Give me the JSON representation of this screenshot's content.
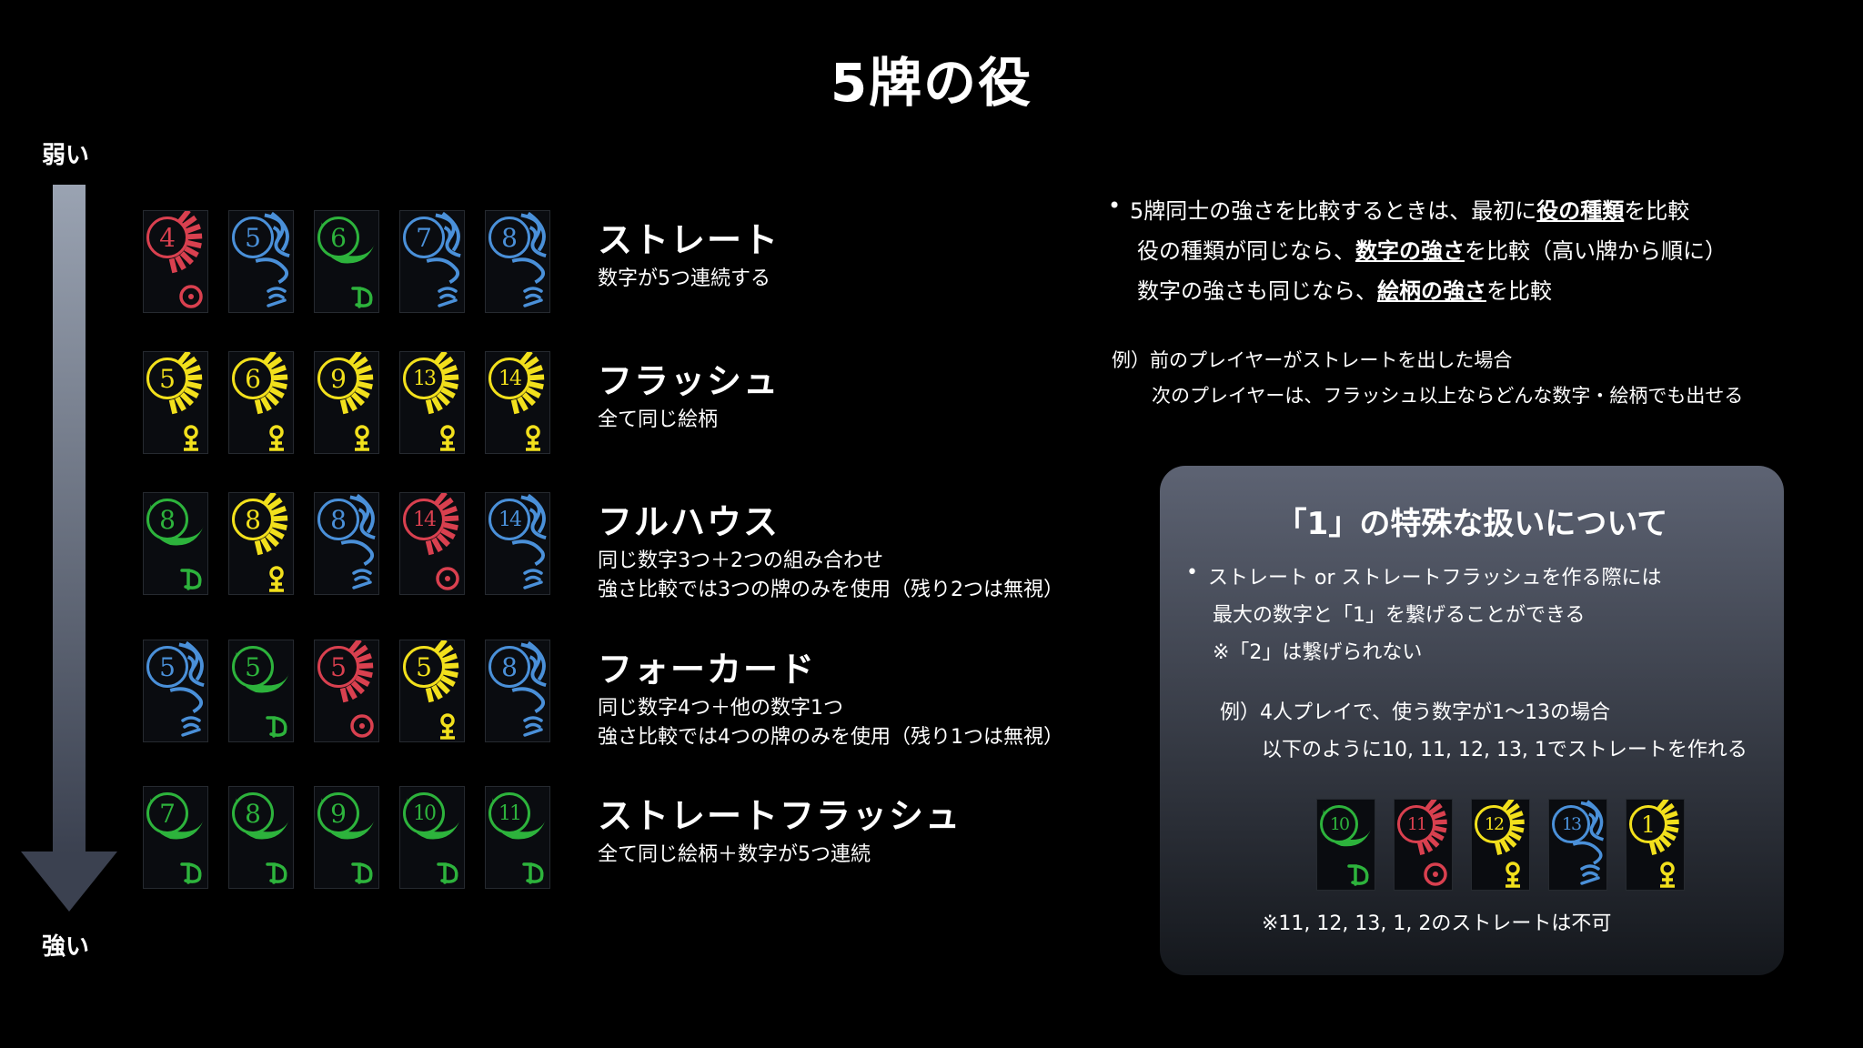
{
  "title": "5牌の役",
  "axis": {
    "top_label": "弱い",
    "bottom_label": "強い"
  },
  "suits": {
    "red": {
      "color": "#d9404f",
      "icon": "sun-symbol-icon"
    },
    "blue": {
      "color": "#4a90d9",
      "icon": "neptune-symbol-icon"
    },
    "green": {
      "color": "#2db33c",
      "icon": "pluto-symbol-icon"
    },
    "yellow": {
      "color": "#f2e01c",
      "icon": "venus-symbol-icon"
    }
  },
  "hands": [
    {
      "name": "ストレート",
      "desc": [
        "数字が5つ連続する"
      ],
      "cards": [
        {
          "n": "4",
          "s": "red"
        },
        {
          "n": "5",
          "s": "blue"
        },
        {
          "n": "6",
          "s": "green"
        },
        {
          "n": "7",
          "s": "blue"
        },
        {
          "n": "8",
          "s": "blue"
        }
      ]
    },
    {
      "name": "フラッシュ",
      "desc": [
        "全て同じ絵柄"
      ],
      "cards": [
        {
          "n": "5",
          "s": "yellow"
        },
        {
          "n": "6",
          "s": "yellow"
        },
        {
          "n": "9",
          "s": "yellow"
        },
        {
          "n": "13",
          "s": "yellow"
        },
        {
          "n": "14",
          "s": "yellow"
        }
      ]
    },
    {
      "name": "フルハウス",
      "desc": [
        "同じ数字3つ＋2つの組み合わせ",
        "強さ比較では3つの牌のみを使用（残り2つは無視）"
      ],
      "cards": [
        {
          "n": "8",
          "s": "green"
        },
        {
          "n": "8",
          "s": "yellow"
        },
        {
          "n": "8",
          "s": "blue"
        },
        {
          "n": "14",
          "s": "red"
        },
        {
          "n": "14",
          "s": "blue"
        }
      ]
    },
    {
      "name": "フォーカード",
      "desc": [
        "同じ数字4つ＋他の数字1つ",
        "強さ比較では4つの牌のみを使用（残り1つは無視）"
      ],
      "cards": [
        {
          "n": "5",
          "s": "blue"
        },
        {
          "n": "5",
          "s": "green"
        },
        {
          "n": "5",
          "s": "red"
        },
        {
          "n": "5",
          "s": "yellow"
        },
        {
          "n": "8",
          "s": "blue"
        }
      ]
    },
    {
      "name": "ストレートフラッシュ",
      "desc": [
        "全て同じ絵柄＋数字が5つ連続"
      ],
      "cards": [
        {
          "n": "7",
          "s": "green"
        },
        {
          "n": "8",
          "s": "green"
        },
        {
          "n": "9",
          "s": "green"
        },
        {
          "n": "10",
          "s": "green"
        },
        {
          "n": "11",
          "s": "green"
        }
      ]
    }
  ],
  "notes": {
    "line1": {
      "pre": "5牌同士の強さを比較するときは、最初に",
      "em": "役の種類",
      "post": "を比較"
    },
    "line2": {
      "pre": "役の種類が同じなら、",
      "em": "数字の強さ",
      "post": "を比較（高い牌から順に）"
    },
    "line3": {
      "pre": "数字の強さも同じなら、",
      "em": "絵柄の強さ",
      "post": "を比較"
    },
    "example1": "例）前のプレイヤーがストレートを出した場合",
    "example2": "次のプレイヤーは、フラッシュ以上ならどんな数字・絵柄でも出せる"
  },
  "panel": {
    "title": "「1」の特殊な扱いについて",
    "line1": "ストレート or ストレートフラッシュを作る際には",
    "line2": "最大の数字と「1」を繋げることができる",
    "line3": "※「2」は繋げられない",
    "example1": "例）4人プレイで、使う数字が1〜13の場合",
    "example2": "以下のように10, 11, 12, 13, 1でストレートを作れる",
    "cards": [
      {
        "n": "10",
        "s": "green"
      },
      {
        "n": "11",
        "s": "red"
      },
      {
        "n": "12",
        "s": "yellow"
      },
      {
        "n": "13",
        "s": "blue"
      },
      {
        "n": "1",
        "s": "yellow"
      }
    ],
    "footnote": "※11, 12, 13, 1, 2のストレートは不可"
  }
}
